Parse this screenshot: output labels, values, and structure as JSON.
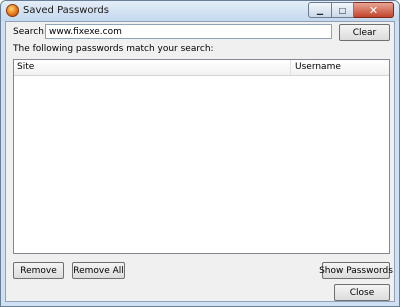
{
  "window": {
    "title": "Saved Passwords",
    "controls": {
      "minimize_glyph": "▁",
      "maximize_glyph": "□",
      "close_glyph": "✕"
    }
  },
  "search": {
    "label": "Search:",
    "value": "www.fixexe.com",
    "clear_label": "Clear"
  },
  "description": "The following passwords match your search:",
  "table": {
    "columns": [
      "Site",
      "Username"
    ],
    "rows": []
  },
  "buttons": {
    "remove": "Remove",
    "remove_all": "Remove All",
    "show_passwords": "Show Passwords",
    "close": "Close"
  }
}
